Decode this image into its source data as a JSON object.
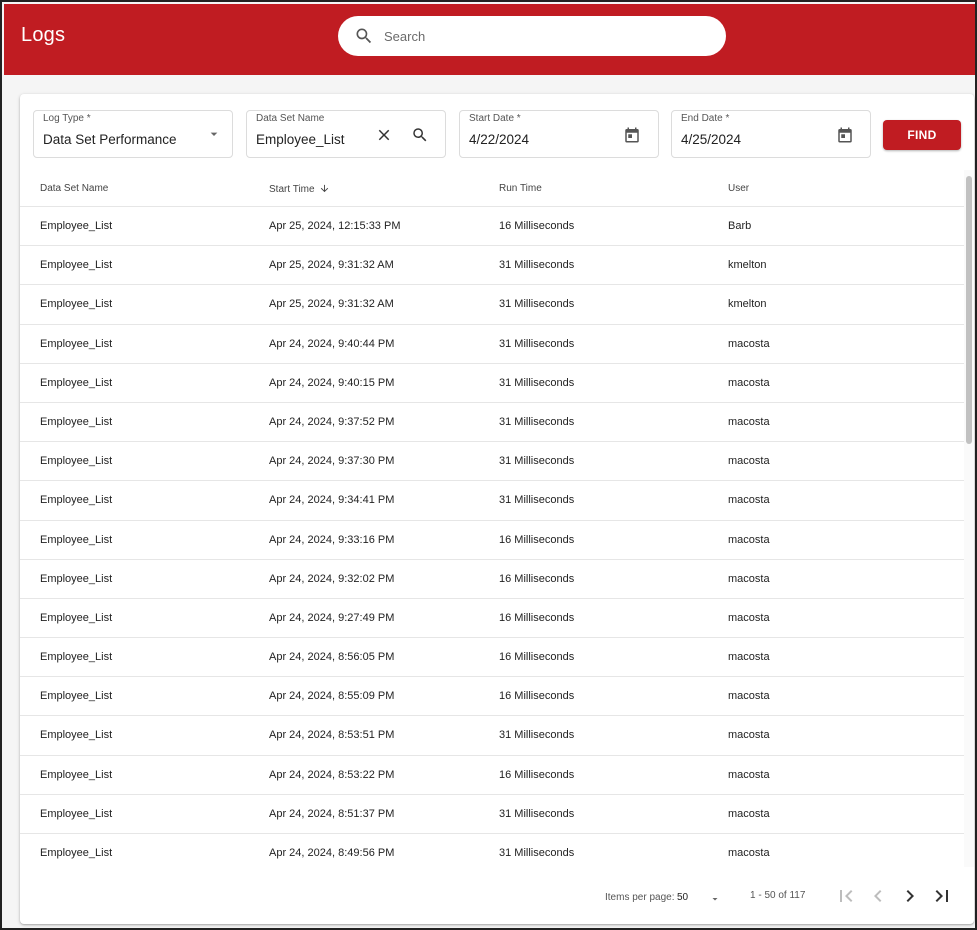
{
  "app": {
    "title": "Logs"
  },
  "search": {
    "placeholder": "Search",
    "value": ""
  },
  "filters": {
    "log_type": {
      "label": "Log Type *",
      "value": "Data Set Performance"
    },
    "data_set_name": {
      "label": "Data Set Name",
      "value": "Employee_List"
    },
    "start_date": {
      "label": "Start Date *",
      "value": "4/22/2024"
    },
    "end_date": {
      "label": "End Date *",
      "value": "4/25/2024"
    },
    "find_label": "FIND"
  },
  "table": {
    "headers": [
      "Data Set Name",
      "Start Time",
      "Run Time",
      "User"
    ],
    "sort": {
      "column": "Start Time",
      "direction": "descending"
    },
    "rows": [
      [
        "Employee_List",
        "Apr 25, 2024, 12:15:33 PM",
        "16 Milliseconds",
        "Barb"
      ],
      [
        "Employee_List",
        "Apr 25, 2024, 9:31:32 AM",
        "31 Milliseconds",
        "kmelton"
      ],
      [
        "Employee_List",
        "Apr 25, 2024, 9:31:32 AM",
        "31 Milliseconds",
        "kmelton"
      ],
      [
        "Employee_List",
        "Apr 24, 2024, 9:40:44 PM",
        "31 Milliseconds",
        "macosta"
      ],
      [
        "Employee_List",
        "Apr 24, 2024, 9:40:15 PM",
        "31 Milliseconds",
        "macosta"
      ],
      [
        "Employee_List",
        "Apr 24, 2024, 9:37:52 PM",
        "31 Milliseconds",
        "macosta"
      ],
      [
        "Employee_List",
        "Apr 24, 2024, 9:37:30 PM",
        "31 Milliseconds",
        "macosta"
      ],
      [
        "Employee_List",
        "Apr 24, 2024, 9:34:41 PM",
        "31 Milliseconds",
        "macosta"
      ],
      [
        "Employee_List",
        "Apr 24, 2024, 9:33:16 PM",
        "16 Milliseconds",
        "macosta"
      ],
      [
        "Employee_List",
        "Apr 24, 2024, 9:32:02 PM",
        "16 Milliseconds",
        "macosta"
      ],
      [
        "Employee_List",
        "Apr 24, 2024, 9:27:49 PM",
        "16 Milliseconds",
        "macosta"
      ],
      [
        "Employee_List",
        "Apr 24, 2024, 8:56:05 PM",
        "16 Milliseconds",
        "macosta"
      ],
      [
        "Employee_List",
        "Apr 24, 2024, 8:55:09 PM",
        "16 Milliseconds",
        "macosta"
      ],
      [
        "Employee_List",
        "Apr 24, 2024, 8:53:51 PM",
        "31 Milliseconds",
        "macosta"
      ],
      [
        "Employee_List",
        "Apr 24, 2024, 8:53:22 PM",
        "16 Milliseconds",
        "macosta"
      ],
      [
        "Employee_List",
        "Apr 24, 2024, 8:51:37 PM",
        "31 Milliseconds",
        "macosta"
      ],
      [
        "Employee_List",
        "Apr 24, 2024, 8:49:56 PM",
        "31 Milliseconds",
        "macosta"
      ]
    ]
  },
  "paginator": {
    "items_per_page_label": "Items per page:",
    "page_size": "50",
    "range_label": "1 - 50 of 117"
  },
  "colors": {
    "brand": "#c01c22",
    "text": "#212121",
    "muted": "#555555"
  },
  "icons": {
    "search": "search-icon",
    "dropdown": "chevron-down-icon",
    "clear": "close-icon",
    "calendar": "calendar-icon",
    "sort": "arrow-down-icon",
    "first": "first-page-icon",
    "prev": "chevron-left-icon",
    "next": "chevron-right-icon",
    "last": "last-page-icon"
  }
}
